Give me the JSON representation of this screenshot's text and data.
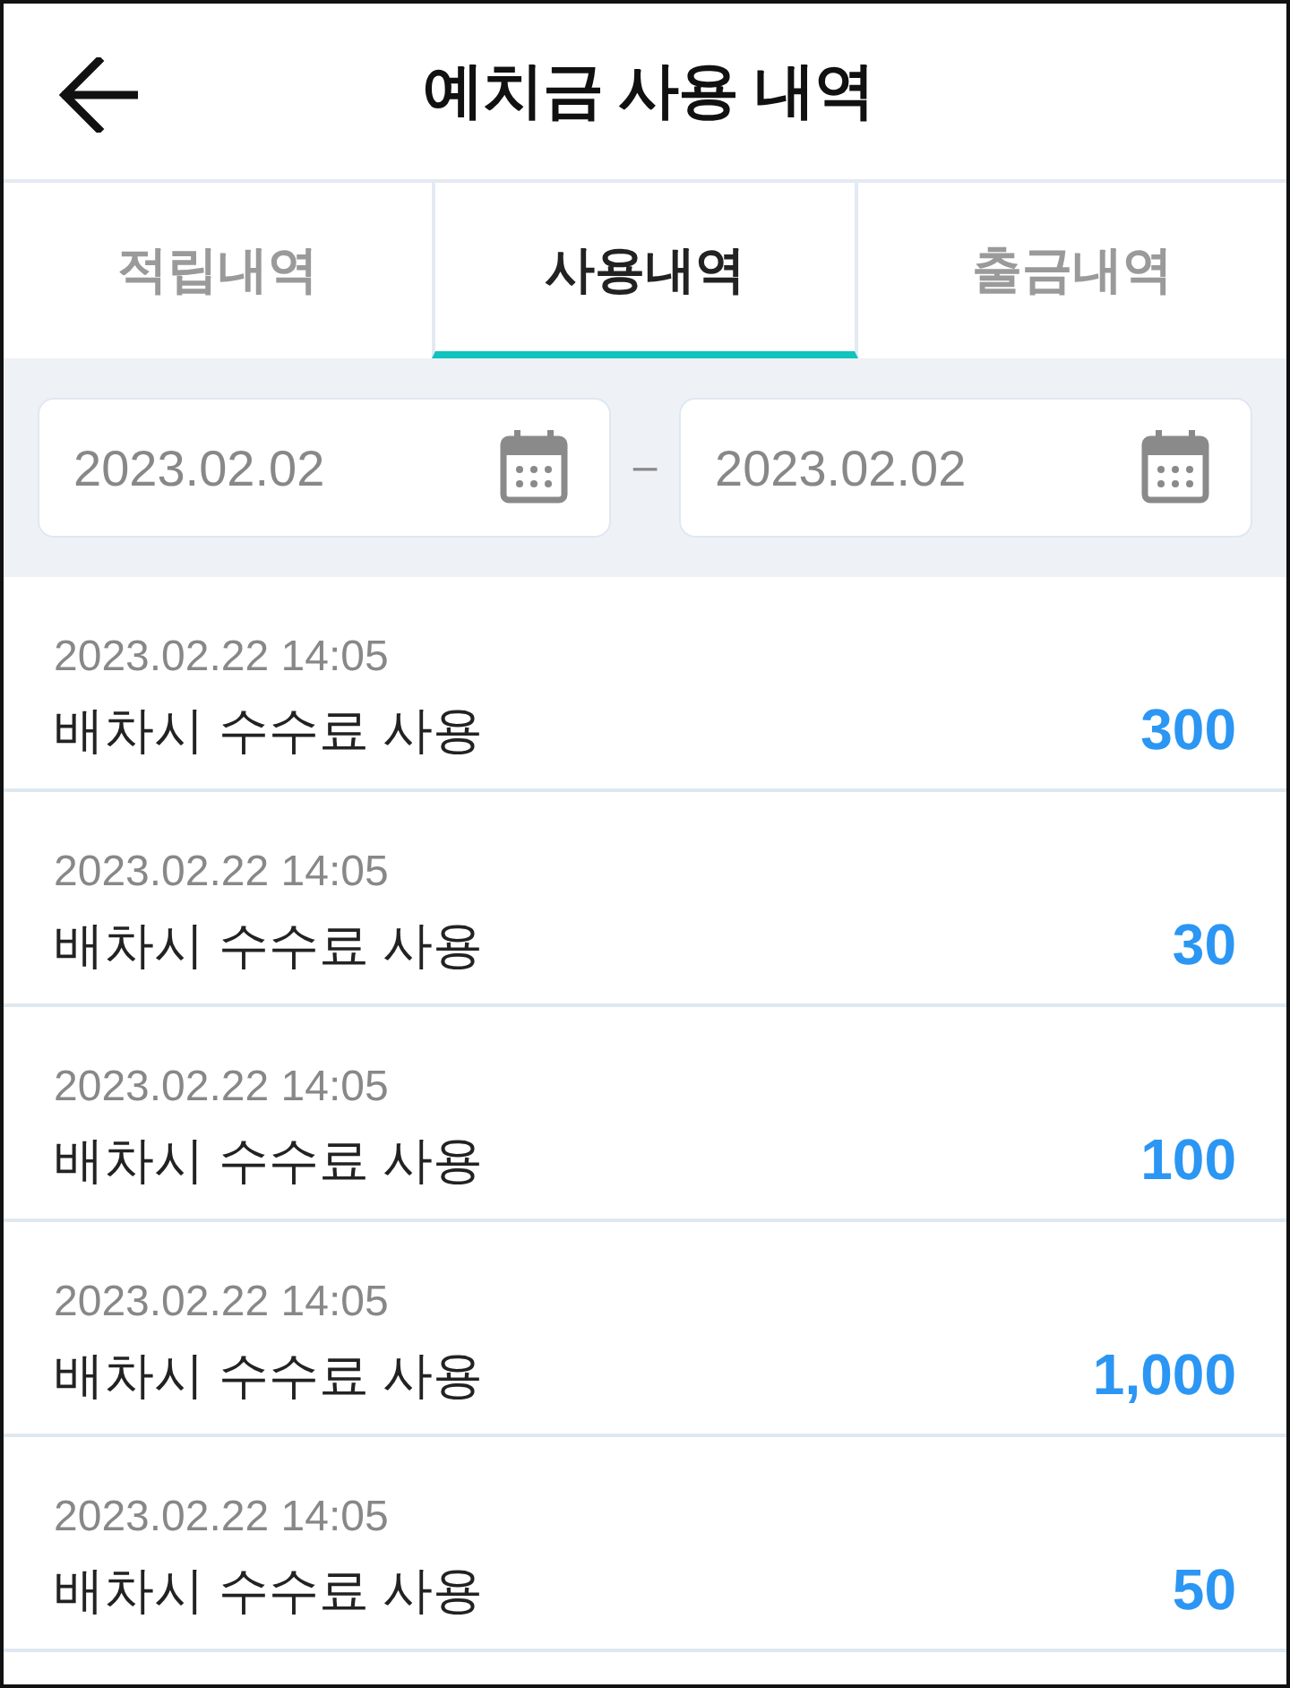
{
  "header": {
    "title": "예치금 사용 내역"
  },
  "tabs": [
    {
      "label": "적립내역",
      "selected": false
    },
    {
      "label": "사용내역",
      "selected": true
    },
    {
      "label": "출금내역",
      "selected": false
    }
  ],
  "date_range": {
    "start": "2023.02.02",
    "separator": "–",
    "end": "2023.02.02"
  },
  "entries": [
    {
      "datetime": "2023.02.22 14:05",
      "description": "배차시 수수료 사용",
      "amount": "300"
    },
    {
      "datetime": "2023.02.22 14:05",
      "description": "배차시 수수료 사용",
      "amount": "30"
    },
    {
      "datetime": "2023.02.22 14:05",
      "description": "배차시 수수료 사용",
      "amount": "100"
    },
    {
      "datetime": "2023.02.22 14:05",
      "description": "배차시 수수료 사용",
      "amount": "1,000"
    },
    {
      "datetime": "2023.02.22 14:05",
      "description": "배차시 수수료 사용",
      "amount": "50"
    }
  ]
}
